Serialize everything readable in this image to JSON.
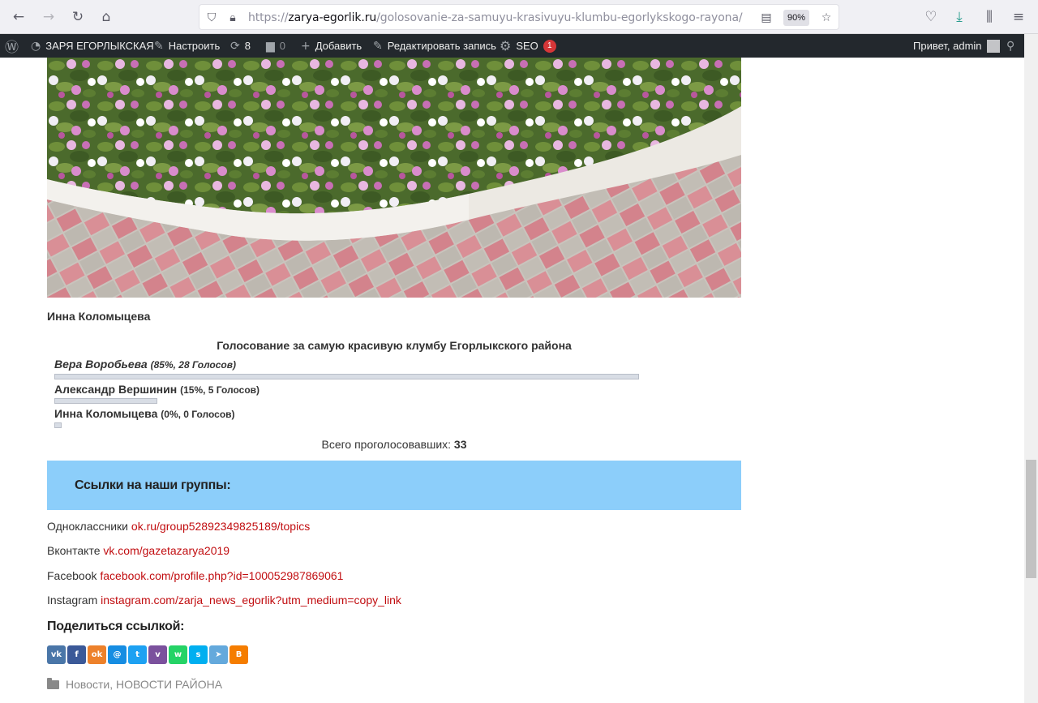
{
  "browser": {
    "url_prefix": "https://",
    "url_host": "zarya-egorlik.ru",
    "url_path": "/golosovanie-za-samuyu-krasivuyu-klumbu-egorlykskogo-rayona/",
    "zoom": "90%"
  },
  "adminbar": {
    "site_name": "ЗАРЯ ЕГОРЛЫКСКАЯ",
    "customize": "Настроить",
    "updates_count": "8",
    "comments_count": "0",
    "add_new": "Добавить",
    "edit_post": "Редактировать запись",
    "seo": "SEO",
    "seo_count": "1",
    "greeting": "Привет, admin"
  },
  "post": {
    "caption": "Инна Коломыцева"
  },
  "poll": {
    "title": "Голосование за самую красивую клумбу Егорлыкского района",
    "options": [
      {
        "name": "Вера Воробьева",
        "meta": "(85%, 28 Голосов)",
        "percent": 85
      },
      {
        "name": "Александр Вершинин",
        "meta": "(15%, 5 Голосов)",
        "percent": 15
      },
      {
        "name": "Инна Коломыцева",
        "meta": "(0%, 0 Голосов)",
        "percent": 0
      }
    ],
    "total_label": "Всего проголосовавших:",
    "total_value": "33"
  },
  "groups": {
    "title": "Ссылки на наши группы:",
    "links": [
      {
        "label": "Одноклассники",
        "url_text": "ok.ru/group52892349825189/topics"
      },
      {
        "label": "Вконтакте",
        "url_text": "vk.com/gazetazarya2019"
      },
      {
        "label": "Facebook",
        "url_text": "facebook.com/profile.php?id=100052987869061"
      },
      {
        "label": "Instagram",
        "url_text": "instagram.com/zarja_news_egorlik?utm_medium=copy_link"
      }
    ]
  },
  "share": {
    "title": "Поделиться ссылкой:",
    "buttons": [
      {
        "name": "vk",
        "glyph": "vk",
        "color": "#4a76a8"
      },
      {
        "name": "facebook",
        "glyph": "f",
        "color": "#3b5998"
      },
      {
        "name": "odnoklassniki",
        "glyph": "ok",
        "color": "#ed812b"
      },
      {
        "name": "moimir",
        "glyph": "@",
        "color": "#168de2"
      },
      {
        "name": "twitter",
        "glyph": "t",
        "color": "#1da1f2"
      },
      {
        "name": "viber",
        "glyph": "v",
        "color": "#7b519d"
      },
      {
        "name": "whatsapp",
        "glyph": "w",
        "color": "#25d366"
      },
      {
        "name": "skype",
        "glyph": "s",
        "color": "#00aff0"
      },
      {
        "name": "telegram",
        "glyph": "➤",
        "color": "#64a9dc"
      },
      {
        "name": "blogger",
        "glyph": "B",
        "color": "#f57d00"
      }
    ]
  },
  "categories": {
    "cat1": "Новости",
    "separator": ",",
    "cat2": "НОВОСТИ РАЙОНА"
  }
}
